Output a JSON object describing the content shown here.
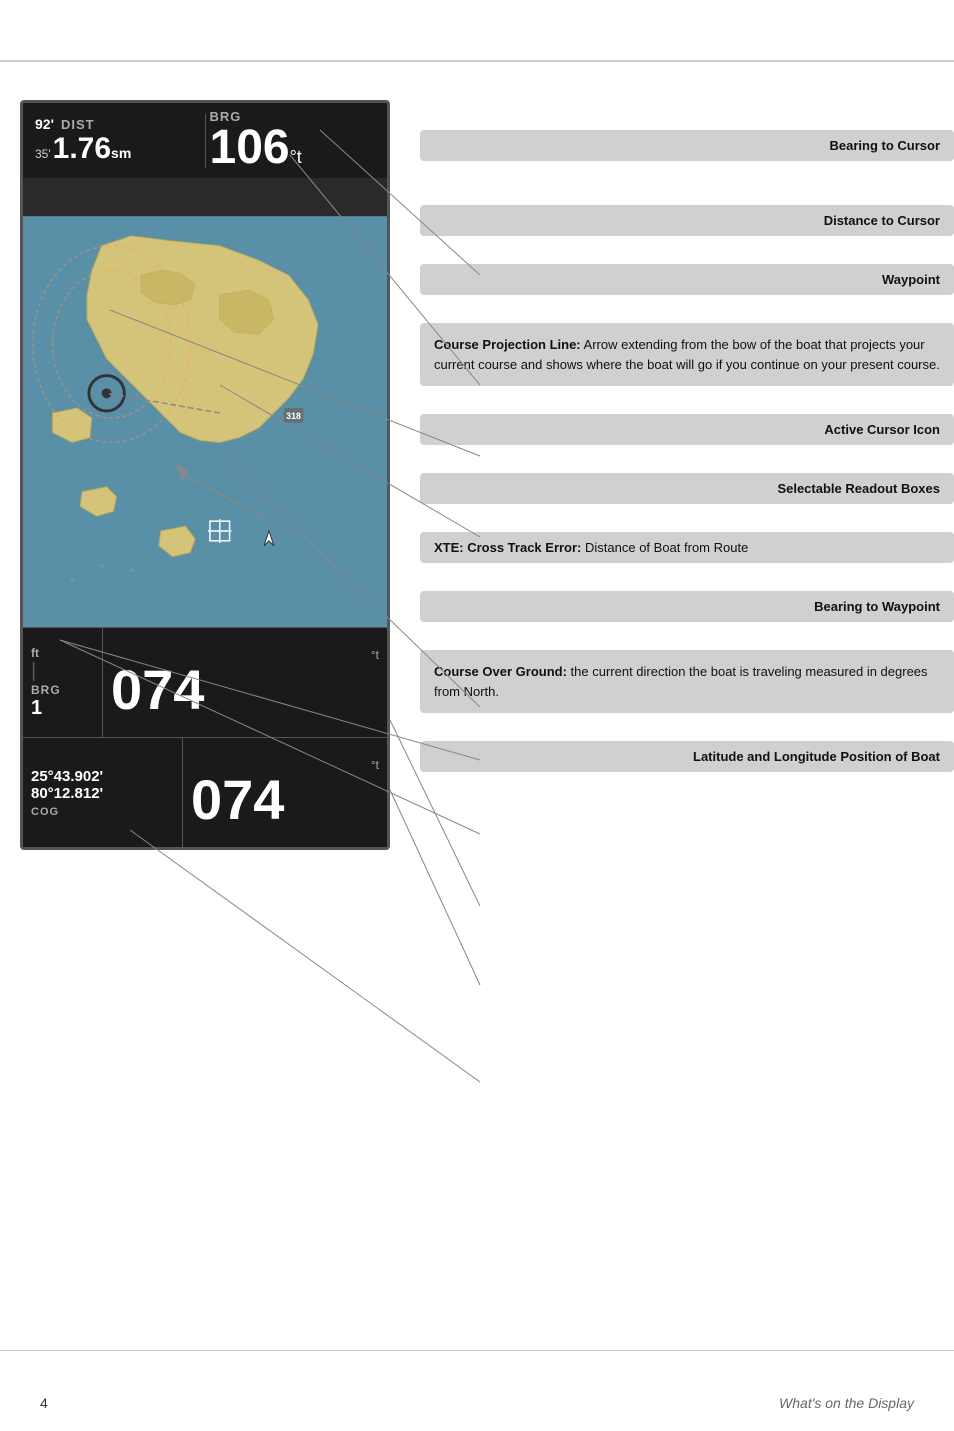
{
  "page": {
    "top_border": true,
    "bottom_border": true,
    "page_number": "4",
    "section_title": "What's on the Display"
  },
  "gps_display": {
    "top_bar": {
      "dist_label": "DIST",
      "dist_prefix": "92'",
      "dist_row2_prefix": "35'",
      "dist_value": "1.76",
      "dist_unit": "sm",
      "brg_label": "BRG",
      "brg_value": "106",
      "brg_unit": "°t"
    },
    "bottom_bar": {
      "row1": {
        "xte_label": "ft",
        "xte_divider": "|",
        "brg_label": "BRG",
        "brg_unit": "°t",
        "brg_value": "074"
      },
      "row2": {
        "lat": "25°43.902'",
        "lon": "80°12.812'",
        "cog_label": "COG",
        "cog_unit": "°t",
        "cog_value": "074"
      }
    }
  },
  "labels": {
    "bearing_to_cursor": "Bearing to Cursor",
    "distance_to_cursor": "Distance to Cursor",
    "waypoint": "Waypoint",
    "course_projection_line_title": "Course Projection Line:",
    "course_projection_line_desc": "Arrow extending from the bow of the boat that projects your current course and shows where the boat will go if you continue on your present course.",
    "active_cursor_icon": "Active Cursor Icon",
    "selectable_readout_boxes": "Selectable Readout Boxes",
    "xte_title": "XTE: Cross Track Error:",
    "xte_desc": "Distance of Boat from Route",
    "bearing_to_waypoint": "Bearing to Waypoint",
    "course_over_ground_title": "Course Over Ground:",
    "course_over_ground_desc": "the current direction the boat is traveling measured in degrees from North.",
    "lat_lon_position": "Latitude and Longitude Position of Boat"
  }
}
